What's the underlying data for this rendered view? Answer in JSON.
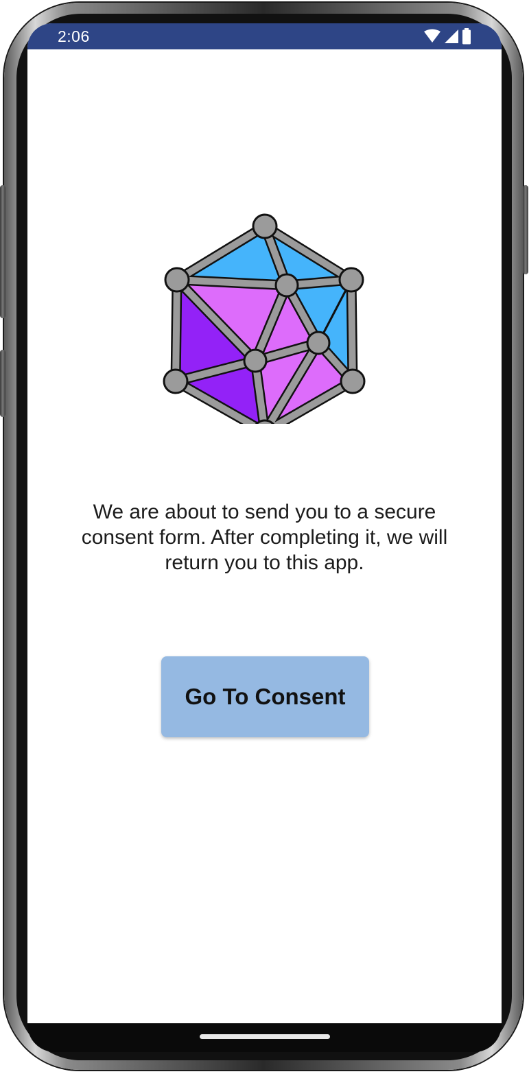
{
  "status_bar": {
    "time": "2:06",
    "background_color": "#2e4586",
    "icons": [
      "wifi-icon",
      "cellular-signal-icon",
      "battery-icon"
    ]
  },
  "logo": {
    "icon": "polyhedron-network-logo",
    "colors": {
      "light_blue": "#45b4fb",
      "pink_violet": "#dd6cfb",
      "purple": "#9322f7",
      "node_gray": "#9b9b9b"
    }
  },
  "main": {
    "message": "We are about to send you to a secure consent form. After completing it, we will return you to this app.",
    "consent_button_label": "Go To Consent",
    "button_color": "#95b9e2"
  }
}
